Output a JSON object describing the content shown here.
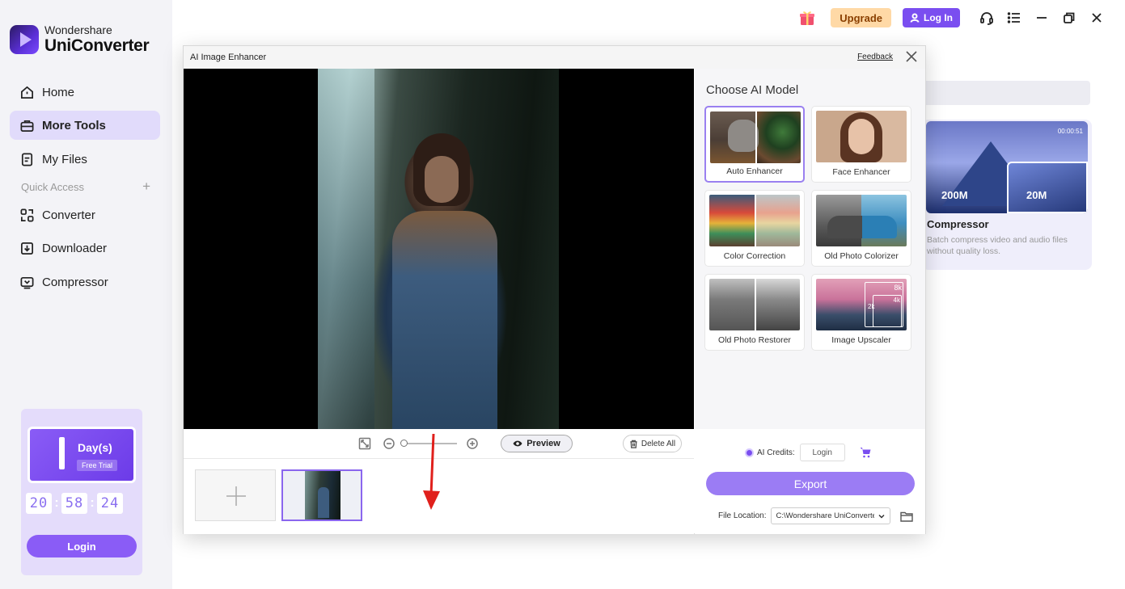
{
  "app": {
    "brand_line1": "Wondershare",
    "brand_line2": "UniConverter"
  },
  "sidebar": {
    "items": [
      {
        "label": "Home",
        "icon": "home-icon"
      },
      {
        "label": "More Tools",
        "icon": "toolbox-icon",
        "active": true
      },
      {
        "label": "My Files",
        "icon": "file-icon"
      }
    ],
    "quick_access_label": "Quick Access",
    "quick_access_add": "+",
    "quick_items": [
      {
        "label": "Converter",
        "icon": "converter-icon"
      },
      {
        "label": "Downloader",
        "icon": "downloader-icon"
      },
      {
        "label": "Compressor",
        "icon": "compressor-icon"
      }
    ]
  },
  "trial": {
    "days_label": "Day(s)",
    "free_trial": "Free Trial",
    "countdown": [
      "20",
      "58",
      "24"
    ],
    "countdown_sep": ":",
    "login_label": "Login"
  },
  "topbar": {
    "upgrade_label": "Upgrade",
    "login_label": "Log In"
  },
  "background_card": {
    "duration": "00:00:51",
    "size_before": "200M",
    "size_after": "20M",
    "title": "Compressor",
    "description": "Batch compress video and audio files without quality loss."
  },
  "modal": {
    "title": "AI Image Enhancer",
    "feedback_label": "Feedback",
    "preview_label": "Preview",
    "delete_all_label": "Delete All",
    "zoom_level": 0,
    "choose_model_title": "Choose AI Model",
    "models": [
      {
        "label": "Auto Enhancer",
        "selected": true
      },
      {
        "label": "Face Enhancer",
        "selected": false
      },
      {
        "label": "Color Correction",
        "selected": false
      },
      {
        "label": "Old Photo Colorizer",
        "selected": false
      },
      {
        "label": "Old Photo Restorer",
        "selected": false
      },
      {
        "label": "Image Upscaler",
        "selected": false
      }
    ],
    "upscaler_badges": [
      "8k",
      "4k",
      "2k"
    ],
    "credits_label": "AI Credits:",
    "credits_login": "Login",
    "export_label": "Export",
    "file_location_label": "File Location:",
    "file_location_value": "C:\\Wondershare UniConverter"
  },
  "colors": {
    "accent": "#7a4ef0",
    "export_button": "#9b7cf4",
    "upgrade_bg": "#ffd9a6",
    "arrow": "#e0201c"
  }
}
